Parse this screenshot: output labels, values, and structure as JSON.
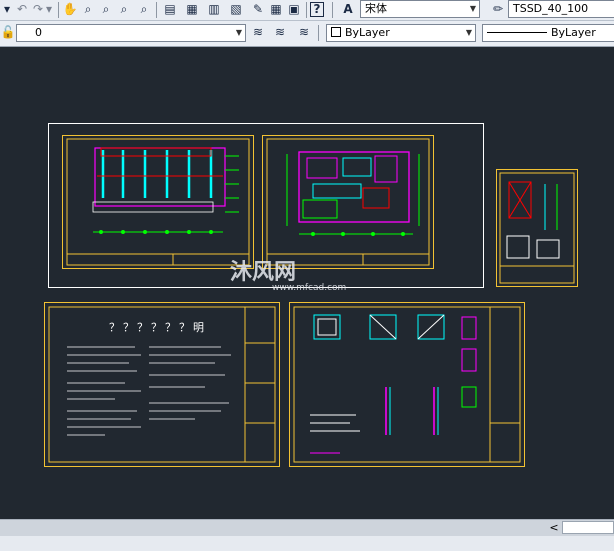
{
  "toolbar_top": {
    "font_name": "宋体",
    "text_style": "TSSD_40_100",
    "help_icon": "question-icon",
    "text_style_icon": "pencil-icon"
  },
  "toolbar_layers": {
    "layer_value": "0",
    "color_value": "ByLayer",
    "linetype_value": "ByLayer"
  },
  "drawings": {
    "notes_title": "？？？？？？明"
  },
  "watermark": {
    "brand": "沐风网",
    "url": "www.mfcad.com"
  },
  "scroll": {
    "left_arrow": "<"
  },
  "colors": {
    "canvas_bg": "#212830",
    "frame": "#f2c233",
    "magenta": "#ff00ff",
    "green": "#00ff00",
    "cyan": "#00ffff",
    "red": "#ff0000"
  }
}
